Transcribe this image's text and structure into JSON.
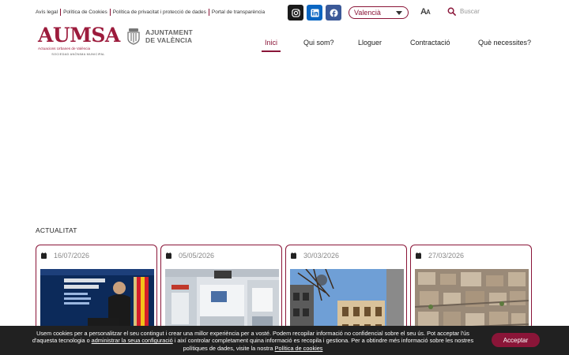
{
  "top_links": [
    "Avís legal",
    "Política de Cookies",
    "Política de privacitat i protecció de dades",
    "Portal de transparència"
  ],
  "social": [
    {
      "icon": "instagram-icon",
      "color": "#1a1a1a"
    },
    {
      "icon": "linkedin-icon",
      "color": "#0a66c2"
    },
    {
      "icon": "facebook-icon",
      "color": "#3b5998"
    }
  ],
  "language": {
    "selected": "Valencià"
  },
  "font_size_toggle": {
    "big": "A",
    "small": "A"
  },
  "search": {
    "placeholder": "Buscar"
  },
  "logos": {
    "aumsa": {
      "name": "AUMSA",
      "tagline": "Actuacions Urbanes de València",
      "subtitle": "SOCIEDAD ANÒNIMA MUNICIPAL"
    },
    "ajuntament": {
      "line1": "AJUNTAMENT",
      "line2": "DE VALÈNCIA"
    }
  },
  "nav": {
    "items": [
      "Inici",
      "Qui som?",
      "Lloguer",
      "Contractació",
      "Què necessites?"
    ],
    "active": "Inici"
  },
  "section": {
    "title": "ACTUALITAT"
  },
  "news": [
    {
      "date": "16/07/2026",
      "image": "press-conference"
    },
    {
      "date": "05/05/2026",
      "image": "office-interior"
    },
    {
      "date": "30/03/2026",
      "image": "building-street"
    },
    {
      "date": "27/03/2026",
      "image": "aerial-city"
    }
  ],
  "cookie": {
    "text_before": "Usem cookies per a personalitzar el seu contingut i crear una millor experiència per a vosté. Podem recopilar informació no confidencial sobre el seu ús. Pot acceptar l'ús d'aquesta tecnologia o ",
    "link1": "administrar la seua configuració",
    "text_middle": " i així controlar completament quina informació es recopila i gestiona. Per a obtindre més informació sobre les nostres polítiques de dades, visite la nostra ",
    "link2": "Política de cookies",
    "accept_label": "Acceptar"
  },
  "colors": {
    "brand": "#8a1538",
    "cookie_bg": "#212121"
  }
}
